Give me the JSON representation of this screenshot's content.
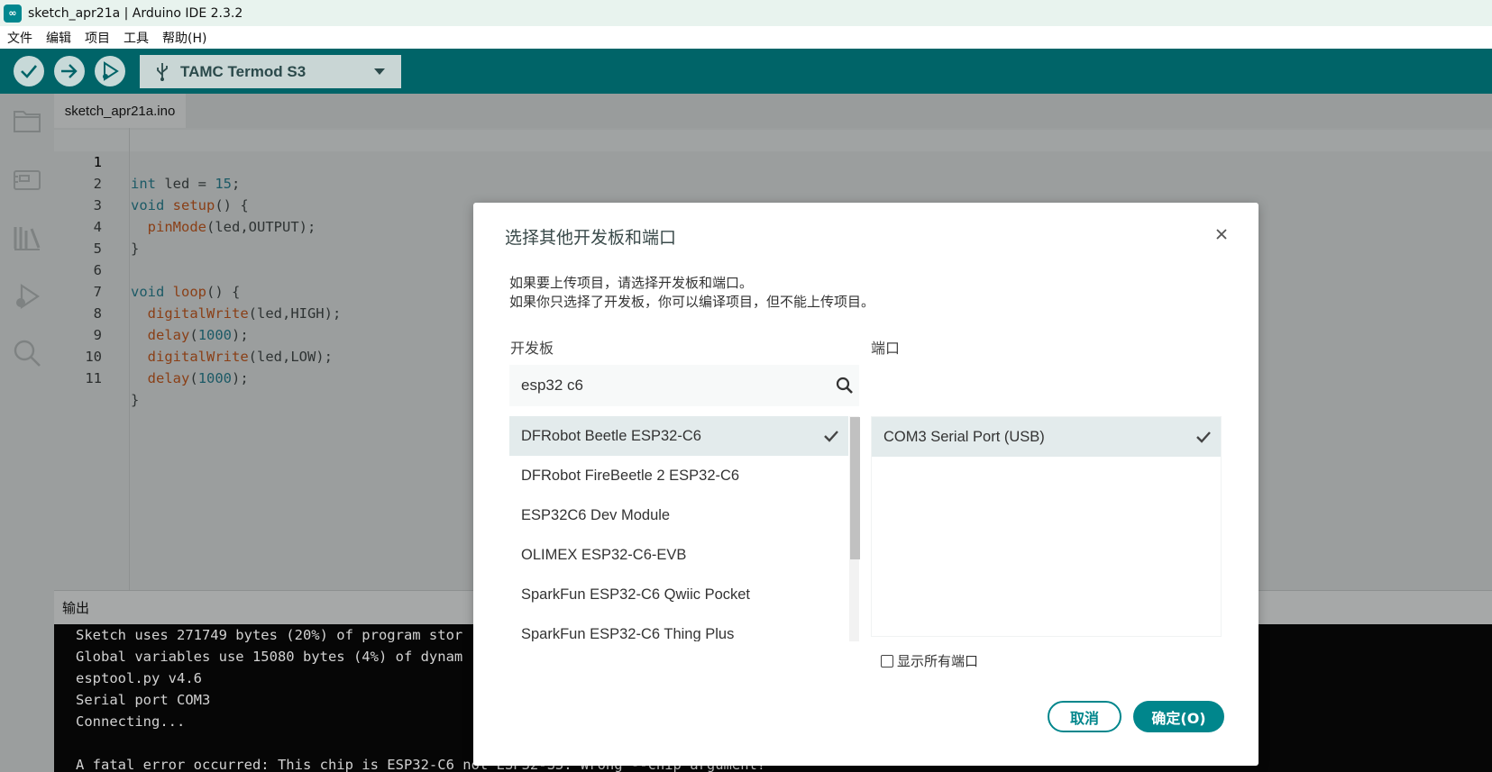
{
  "window": {
    "title": "sketch_apr21a | Arduino IDE 2.3.2",
    "app_icon_glyph": "∞"
  },
  "menubar": {
    "items": [
      "文件",
      "编辑",
      "项目",
      "工具",
      "帮助(H)"
    ]
  },
  "toolbar": {
    "board_name": "TAMC Termod S3",
    "icons": [
      "verify-icon",
      "upload-icon",
      "debug-icon",
      "usb-icon"
    ]
  },
  "sidebar": {
    "icons": [
      "folder-icon",
      "board-manager-icon",
      "library-icon",
      "debug-icon",
      "search-icon"
    ]
  },
  "editor": {
    "tab_label": "sketch_apr21a.ino",
    "line_numbers": [
      "1",
      "2",
      "3",
      "4",
      "5",
      "6",
      "7",
      "8",
      "9",
      "10",
      "11"
    ]
  },
  "output": {
    "header": "输出",
    "lines": [
      "Sketch uses 271749 bytes (20%) of program stor",
      "Global variables use 15080 bytes (4%) of dynam",
      "esptool.py v4.6",
      "Serial port COM3",
      "Connecting...",
      "",
      "A fatal error occurred: This chip is ESP32-C6 not ESP32-S3. Wrong --chip argument?"
    ]
  },
  "dialog": {
    "title": "选择其他开发板和端口",
    "desc_line1": "如果要上传项目，请选择开发板和端口。",
    "desc_line2": "如果你只选择了开发板，你可以编译项目，但不能上传项目。",
    "boards_header": "开发板",
    "ports_header": "端口",
    "search_value": "esp32 c6",
    "boards": [
      "DFRobot Beetle ESP32-C6",
      "DFRobot FireBeetle 2 ESP32-C6",
      "ESP32C6 Dev Module",
      "OLIMEX ESP32-C6-EVB",
      "SparkFun ESP32-C6 Qwiic Pocket",
      "SparkFun ESP32-C6 Thing Plus"
    ],
    "selected_board_index": 0,
    "ports": [
      "COM3 Serial Port (USB)"
    ],
    "show_all_ports_label": "显示所有端口",
    "show_all_ports_checked": false,
    "cancel_label": "取消",
    "ok_label": "确定(O)"
  },
  "colors": {
    "toolbar": "#006468",
    "accent": "#00868c",
    "selection": "#e3ebec"
  }
}
